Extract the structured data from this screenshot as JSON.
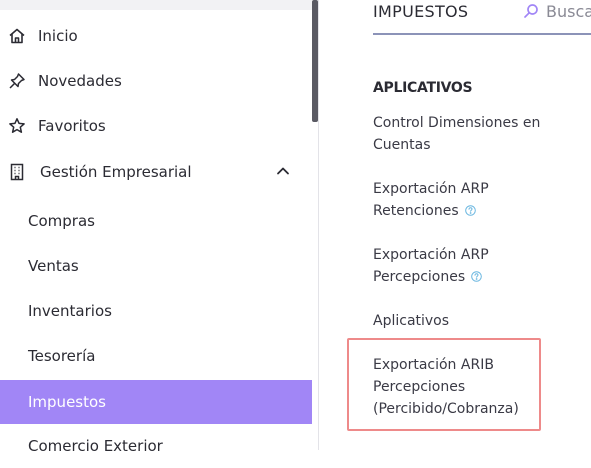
{
  "sidebar": {
    "items": [
      {
        "label": "Inicio",
        "icon": "home-icon"
      },
      {
        "label": "Novedades",
        "icon": "pin-icon"
      },
      {
        "label": "Favoritos",
        "icon": "star-icon"
      },
      {
        "label": "Gestión Empresarial",
        "icon": "building-icon",
        "expanded": true
      }
    ],
    "sub_items": [
      {
        "label": "Compras"
      },
      {
        "label": "Ventas"
      },
      {
        "label": "Inventarios"
      },
      {
        "label": "Tesorería"
      },
      {
        "label": "Impuestos",
        "active": true
      },
      {
        "label": "Comercio Exterior"
      }
    ],
    "active_color": "#a186f6"
  },
  "main": {
    "title": "IMPUESTOS",
    "search": {
      "placeholder": "Buscar"
    },
    "section": "APLICATIVOS",
    "links": [
      {
        "line1": "Control Dimensiones en",
        "line2": "Cuentas",
        "help": false
      },
      {
        "line1": "Exportación ARP",
        "line2": "Retenciones",
        "help": true
      },
      {
        "line1": "Exportación ARP",
        "line2": "Percepciones",
        "help": true
      },
      {
        "line1": "Aplicativos",
        "help": false
      },
      {
        "line1": "Exportación ARIB",
        "line2": "Percepciones",
        "line3": "(Percibido/Cobranza)",
        "help": false,
        "highlighted": true
      }
    ],
    "highlight_color": "#ee8a8a"
  }
}
